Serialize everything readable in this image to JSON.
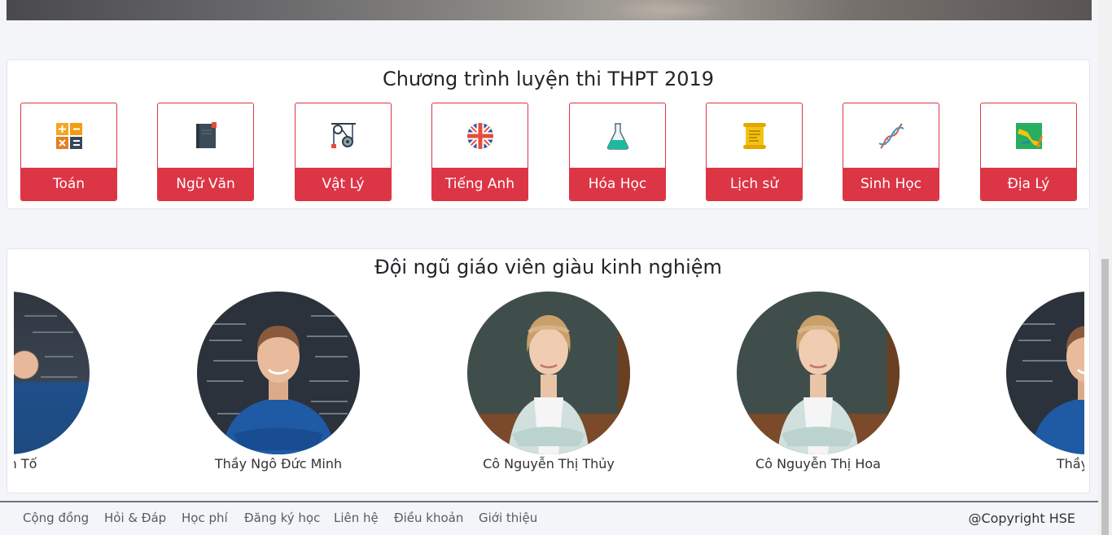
{
  "programs": {
    "title": "Chương trình luyện thi THPT 2019",
    "subjects": [
      {
        "label": "Toán",
        "icon": "calculator-icon"
      },
      {
        "label": "Ngữ Văn",
        "icon": "book-icon"
      },
      {
        "label": "Vật Lý",
        "icon": "pulley-icon"
      },
      {
        "label": "Tiếng Anh",
        "icon": "uk-flag-icon"
      },
      {
        "label": "Hóa Học",
        "icon": "flask-icon"
      },
      {
        "label": "Lịch sử",
        "icon": "scroll-icon"
      },
      {
        "label": "Sinh Học",
        "icon": "dna-icon"
      },
      {
        "label": "Địa Lý",
        "icon": "map-icon"
      }
    ]
  },
  "teachers": {
    "title": "Đội ngũ giáo viên giàu kinh nghiệm",
    "items": [
      {
        "name": "n Văn Tố"
      },
      {
        "name": "Thầy Ngô Đức Minh"
      },
      {
        "name": "Cô Nguyễn Thị Thủy"
      },
      {
        "name": "Cô Nguyễn Thị Hoa"
      },
      {
        "name": "Thầy Đoà"
      }
    ]
  },
  "footer": {
    "links": [
      "Cộng đồng",
      "Hỏi & Đáp",
      "Học phí",
      "Đăng ký học",
      "Liên hệ",
      "Điều khoản",
      "Giới thiệu"
    ],
    "copyright": "@Copyright HSE"
  },
  "colors": {
    "accent": "#dc3545",
    "background": "#f4f5f8"
  }
}
